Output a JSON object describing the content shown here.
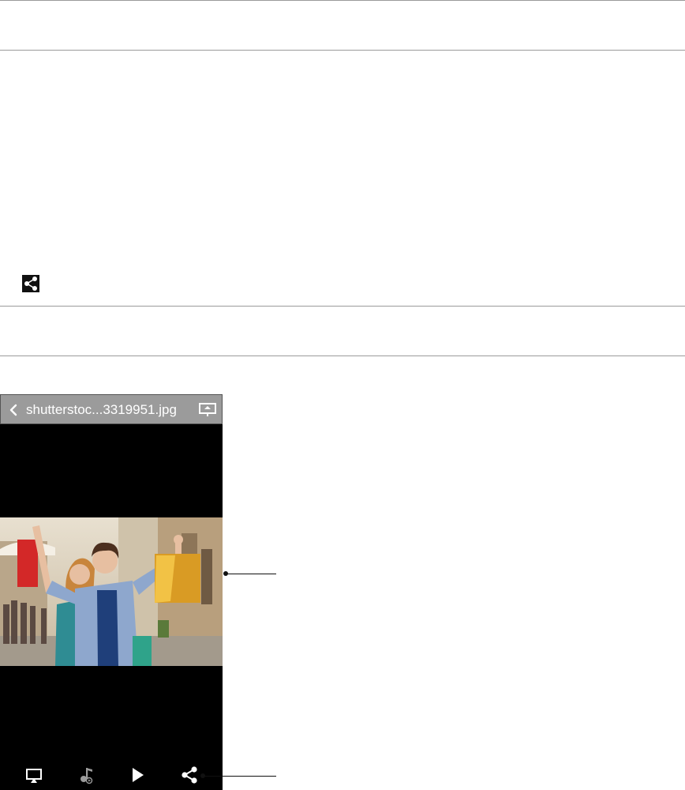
{
  "viewer": {
    "file_name": "shutterstoc...3319951.jpg",
    "icons": {
      "back": "chevron-left-icon",
      "cast": "cast-screen-icon",
      "toolbar": [
        "screen-mirror-icon",
        "music-playlist-icon",
        "play-icon",
        "share-icon"
      ],
      "section_header": "share-icon"
    }
  },
  "colors": {
    "title_bar": "#9b9b9b",
    "viewer_background": "#000000",
    "icon": "#ffffff",
    "rule": "#9a9a9a"
  }
}
